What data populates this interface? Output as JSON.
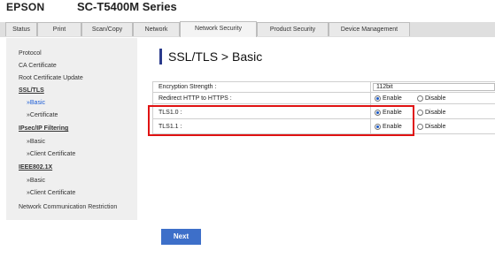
{
  "header": {
    "brand": "EPSON",
    "model": "SC-T5400M Series"
  },
  "tabs": [
    {
      "label": "Status"
    },
    {
      "label": "Print"
    },
    {
      "label": "Scan/Copy"
    },
    {
      "label": "Network"
    },
    {
      "label": "Network Security",
      "active": true
    },
    {
      "label": "Product Security"
    },
    {
      "label": "Device Management"
    }
  ],
  "sidebar": {
    "items": [
      {
        "label": "Protocol"
      },
      {
        "label": "CA Certificate"
      },
      {
        "label": "Root Certificate Update"
      },
      {
        "label": "SSL/TLS"
      },
      {
        "label": "»Basic"
      },
      {
        "label": "»Certificate"
      },
      {
        "label": "IPsec/IP Filtering"
      },
      {
        "label": "»Basic"
      },
      {
        "label": "»Client Certificate"
      },
      {
        "label": "IEEE802.1X"
      },
      {
        "label": "»Basic"
      },
      {
        "label": "»Client Certificate"
      },
      {
        "label": "Network Communication Restriction"
      }
    ]
  },
  "page": {
    "title": "SSL/TLS > Basic",
    "rows": [
      {
        "label": "Encryption Strength :",
        "value": "112bit"
      },
      {
        "label": "Redirect HTTP to HTTPS :",
        "enable": "Enable",
        "disable": "Disable",
        "selected": "Enable"
      },
      {
        "label": "TLS1.0 :",
        "enable": "Enable",
        "disable": "Disable",
        "selected": "Enable"
      },
      {
        "label": "TLS1.1 :",
        "enable": "Enable",
        "disable": "Disable",
        "selected": "Enable"
      }
    ],
    "next_label": "Next"
  },
  "colors": {
    "accent": "#3d6fc9",
    "highlight": "#e01212",
    "title_bar": "#2a3b8c"
  }
}
